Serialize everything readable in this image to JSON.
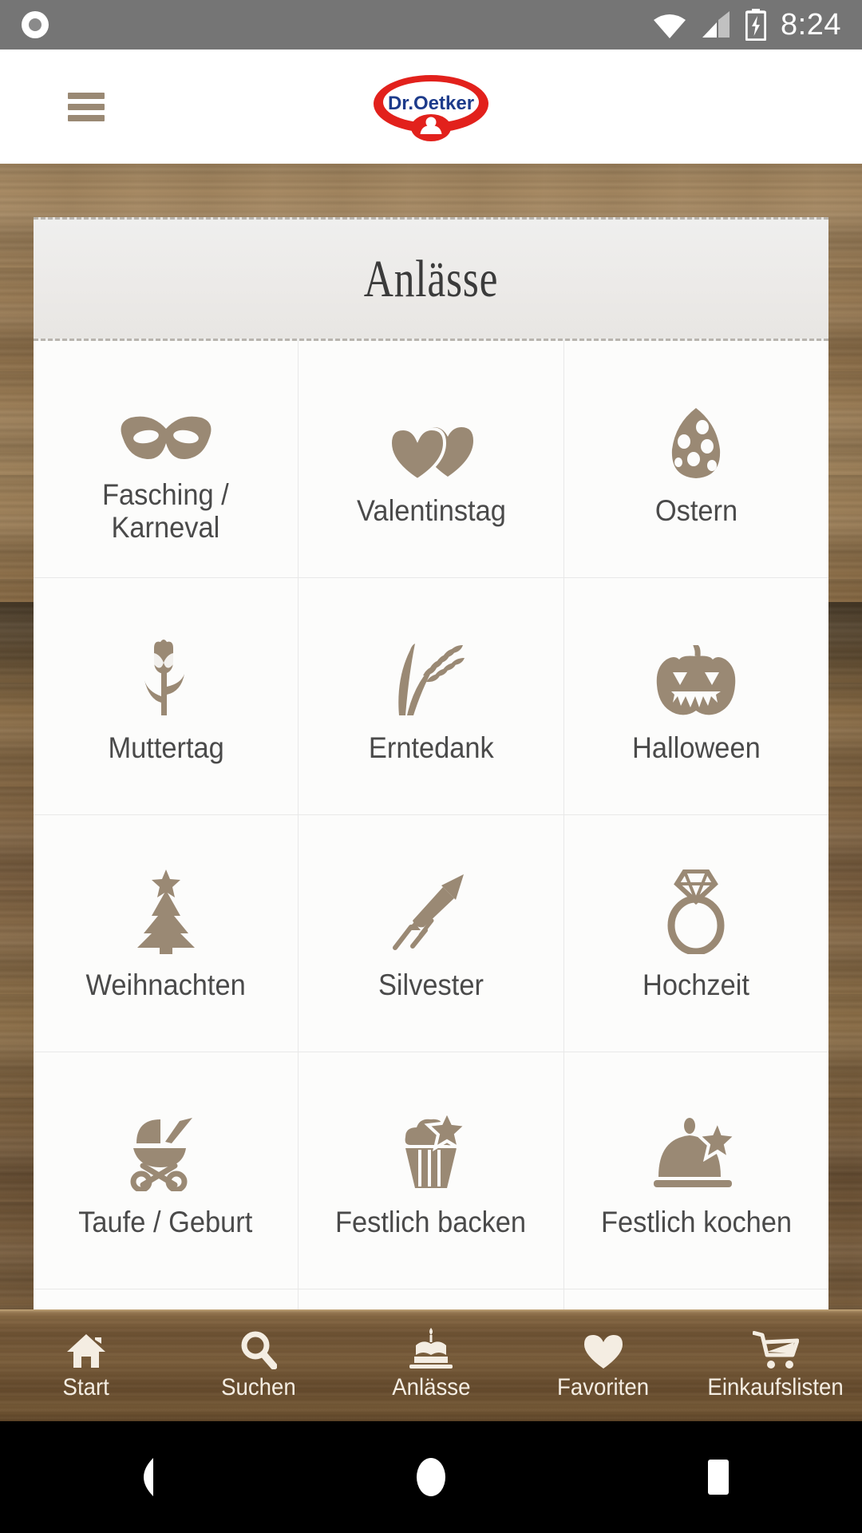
{
  "status_bar": {
    "time": "8:24",
    "icons": [
      "notification-dot-icon",
      "wifi-icon",
      "cellular-signal-icon",
      "battery-charging-icon"
    ],
    "background_color": "#757575"
  },
  "header": {
    "menu_icon": "hamburger-menu-icon",
    "logo": {
      "brand_line": "Dr.Oetker",
      "red": "#e2211c",
      "blue": "#1d3b8b"
    }
  },
  "page": {
    "title": "Anlässe",
    "accent_color": "#9a8974",
    "background": "wood-texture"
  },
  "grid": {
    "tiles": [
      {
        "label": "Fasching /\nKarneval",
        "label_line1": "Fasching /",
        "label_line2": "Karneval",
        "icon": "carnival-mask-icon"
      },
      {
        "label": "Valentinstag",
        "icon": "two-hearts-icon"
      },
      {
        "label": "Ostern",
        "icon": "easter-egg-icon"
      },
      {
        "label": "Muttertag",
        "icon": "tulip-flower-icon"
      },
      {
        "label": "Erntedank",
        "icon": "wheat-stalk-icon"
      },
      {
        "label": "Halloween",
        "icon": "jack-o-lantern-icon"
      },
      {
        "label": "Weihnachten",
        "icon": "christmas-tree-icon"
      },
      {
        "label": "Silvester",
        "icon": "firework-rocket-icon"
      },
      {
        "label": "Hochzeit",
        "icon": "diamond-ring-icon"
      },
      {
        "label": "Taufe / Geburt",
        "icon": "baby-stroller-icon"
      },
      {
        "label": "Festlich backen",
        "icon": "cupcake-star-icon"
      },
      {
        "label": "Festlich kochen",
        "icon": "serving-dome-star-icon"
      }
    ]
  },
  "bottom_nav": {
    "items": [
      {
        "label": "Start",
        "icon": "home-icon"
      },
      {
        "label": "Suchen",
        "icon": "search-icon"
      },
      {
        "label": "Anlässe",
        "icon": "birthday-cake-icon"
      },
      {
        "label": "Favoriten",
        "icon": "heart-icon"
      },
      {
        "label": "Einkaufslisten",
        "icon": "shopping-cart-icon"
      }
    ],
    "active": "Anlässe"
  },
  "android_nav": {
    "back": "back-triangle-icon",
    "home": "home-circle-icon",
    "recents": "recents-square-icon"
  }
}
